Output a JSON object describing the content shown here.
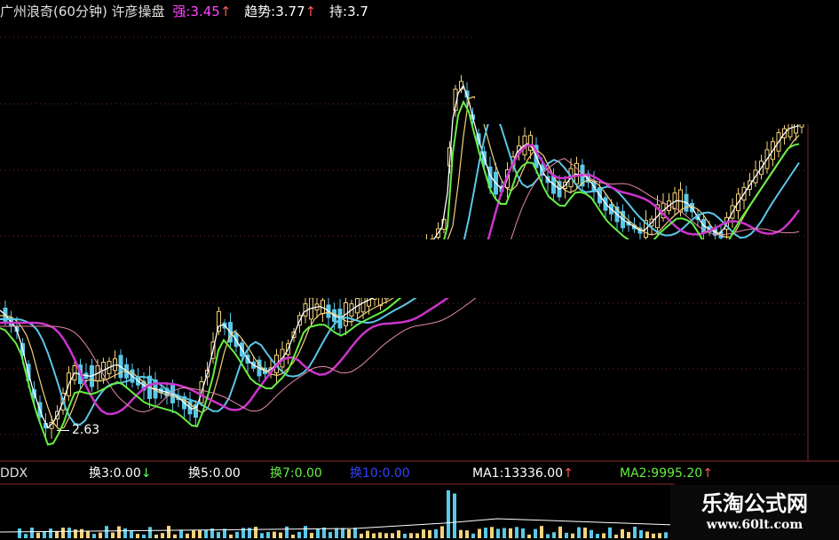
{
  "header": {
    "title": "广州浪奇(60分钟) 许彦操盘",
    "strong_label": "强:",
    "strong_value": "3.45",
    "trend_label": "趋势:",
    "trend_value": "3.77",
    "hold_label": "持:",
    "hold_value": "3.7",
    "up_arrow": "↑"
  },
  "price_panel": {
    "low_marker": "2.63",
    "bull_color": "#f3d27a",
    "bear_color": "#5ac8e8",
    "green_color": "#66ee44"
  },
  "indicator_bar": {
    "name": "DDX",
    "items": [
      {
        "text": "换3:0.00",
        "arrow": "↓",
        "color": "#ffffff"
      },
      {
        "text": "换5:0.00",
        "arrow": "",
        "color": "#ffffff"
      },
      {
        "text": "换7:0.00",
        "arrow": "",
        "color": "#66ee44"
      },
      {
        "text": "换10:0.00",
        "arrow": "",
        "color": "#3344ff"
      },
      {
        "text": "MA1:13336.00",
        "arrow": "↑",
        "color": "#ffffff"
      },
      {
        "text": "MA2:9995.20",
        "arrow": "↑",
        "color": "#66ee44"
      }
    ]
  },
  "watermark": {
    "title": "乐淘公式网",
    "url": "www.60lt.com"
  }
}
